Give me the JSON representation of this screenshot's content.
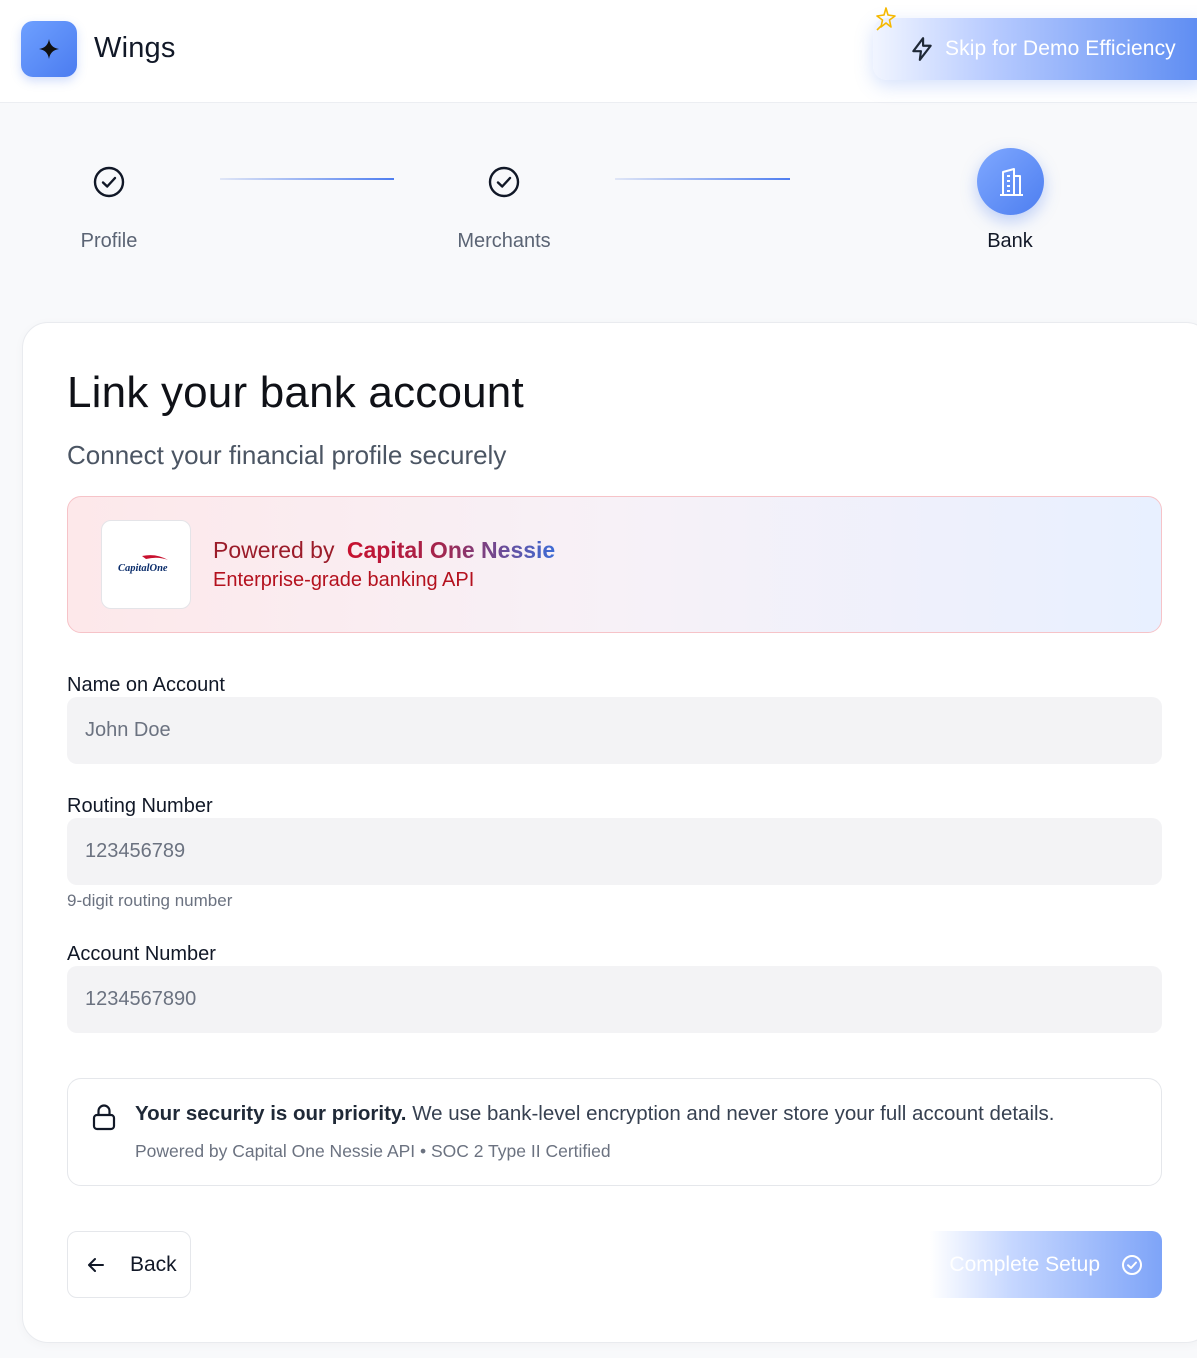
{
  "header": {
    "app_name": "Wings",
    "skip_button_label": "Skip for Demo Efficiency"
  },
  "stepper": {
    "steps": [
      {
        "label": "Profile",
        "status": "completed"
      },
      {
        "label": "Merchants",
        "status": "completed"
      },
      {
        "label": "Bank",
        "status": "active"
      }
    ]
  },
  "page": {
    "title": "Link your bank account",
    "subtitle": "Connect your financial profile securely"
  },
  "provider": {
    "powered_prefix": "Powered by",
    "brand_name": "Capital One Nessie",
    "tagline": "Enterprise-grade banking API",
    "logo_text": "CapitalOne"
  },
  "form": {
    "name": {
      "label": "Name on Account",
      "placeholder": "John Doe",
      "value": ""
    },
    "routing": {
      "label": "Routing Number",
      "placeholder": "123456789",
      "value": "",
      "hint": "9-digit routing number"
    },
    "account": {
      "label": "Account Number",
      "placeholder": "1234567890",
      "value": ""
    }
  },
  "security": {
    "headline": "Your security is our priority.",
    "body": " We use bank-level encryption and never store your full account details.",
    "footnote": "Powered by Capital One Nessie API • SOC 2 Type II Certified"
  },
  "actions": {
    "back_label": "Back",
    "complete_label": "Complete Setup"
  },
  "colors": {
    "accent": "#4f7ef0",
    "brand_red": "#c8102e"
  }
}
